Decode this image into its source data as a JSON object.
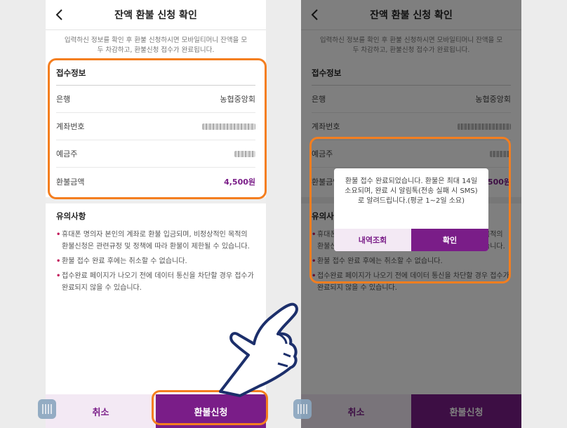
{
  "screen": {
    "title": "잔액 환불 신청 확인",
    "intro": "입력하신 정보를 확인 후 환불 신청하시면 모바일티머니 잔액을 모두 차감하고, 환불신청 접수가 완료됩니다.",
    "info_title": "접수정보",
    "rows": [
      {
        "label": "은행",
        "value": "농협중앙회"
      },
      {
        "label": "계좌번호",
        "value": ""
      },
      {
        "label": "예금주",
        "value": ""
      },
      {
        "label": "환불금액",
        "value": "4,500원"
      }
    ],
    "notes_title": "유의사항",
    "notes": [
      "휴대폰 명의자 본인의 계좌로 환불 입금되며, 비정상적인 목적의 환불신청은 관련규정 및 정책에 따라 환불이 제한될 수 있습니다.",
      "환불 접수 완료 후에는 취소할 수 없습니다.",
      "접수완료 페이지가 나오기 전에 데이터 통신을 차단할 경우 접수가 완료되지 않을 수 있습니다."
    ],
    "bullet": "•",
    "cancel_label": "취소",
    "submit_label": "환불신청"
  },
  "dialog": {
    "message": "환불 접수 완료되었습니다. 환불은 최대 14일 소요되며, 완료 시 알림톡(전송 실패 시 SMS)로 알려드립니다.(평균 1~2일 소요)",
    "history_label": "내역조회",
    "ok_label": "확인"
  },
  "colors": {
    "brand_purple": "#7a1d88",
    "highlight_orange": "#f47e1f",
    "bullet_red": "#c2185b"
  },
  "icons": [
    "back-arrow-icon",
    "chat-icon",
    "pointing-hand-icon"
  ]
}
